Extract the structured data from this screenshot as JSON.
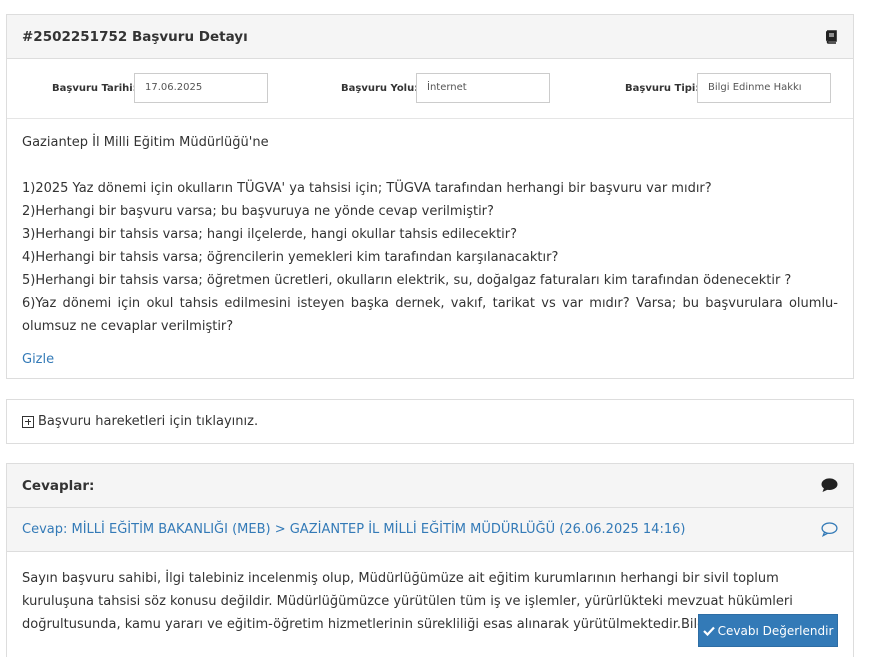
{
  "detail": {
    "title": "#2502251752 Başvuru Detayı",
    "icon": "book-icon",
    "fields": {
      "date_label": "Başvuru Tarihi:",
      "date_value": "17.06.2025",
      "route_label": "Başvuru Yolu:",
      "route_value": "İnternet",
      "type_label": "Başvuru Tipi:",
      "type_value": "Bilgi Edinme Hakkı"
    },
    "addressee": "Gaziantep İl Milli Eğitim Müdürlüğü'ne",
    "questions": [
      "1)2025 Yaz dönemi için okulların TÜGVA' ya tahsisi için; TÜGVA tarafından herhangi bir başvuru var mıdır?",
      "2)Herhangi bir başvuru varsa; bu başvuruya ne yönde cevap verilmiştir?",
      "3)Herhangi bir tahsis varsa; hangi ilçelerde, hangi okullar tahsis edilecektir?",
      "4)Herhangi bir tahsis varsa; öğrencilerin yemekleri kim tarafından karşılanacaktır?",
      "5)Herhangi bir tahsis varsa; öğretmen ücretleri, okulların elektrik, su, doğalgaz faturaları kim tarafından ödenecektir ?",
      "6)Yaz dönemi için okul tahsis edilmesini isteyen başka dernek, vakıf, tarikat vs var mıdır? Varsa; bu başvurulara olumlu-olumsuz ne cevaplar verilmiştir?"
    ],
    "hide_label": "Gizle"
  },
  "history": {
    "label": "Başvuru hareketleri için tıklayınız."
  },
  "answers": {
    "title": "Cevaplar:",
    "answer_title": "Cevap: MİLLİ EĞİTİM BAKANLIĞI (MEB) > GAZİANTEP İL MİLLİ EĞİTİM MÜDÜRLÜĞÜ (26.06.2025 14:16)",
    "answer_text": "Sayın başvuru sahibi, İlgi talebiniz incelenmiş olup, Müdürlüğümüze ait eğitim kurumlarının herhangi bir sivil toplum kuruluşuna tahsisi söz konusu değildir. Müdürlüğümüzce yürütülen tüm iş ve işlemler, yürürlükteki mevzuat hükümleri doğrultusunda, kamu yararı ve eğitim-öğretim hizmetlerinin sürekliliği esas alınarak yürütülmektedir.Bilgilerinize sunulur.",
    "rate_label": "Cevabı Değerlendir",
    "colors": {
      "link": "#337ab7",
      "button": "#337ab7"
    }
  }
}
